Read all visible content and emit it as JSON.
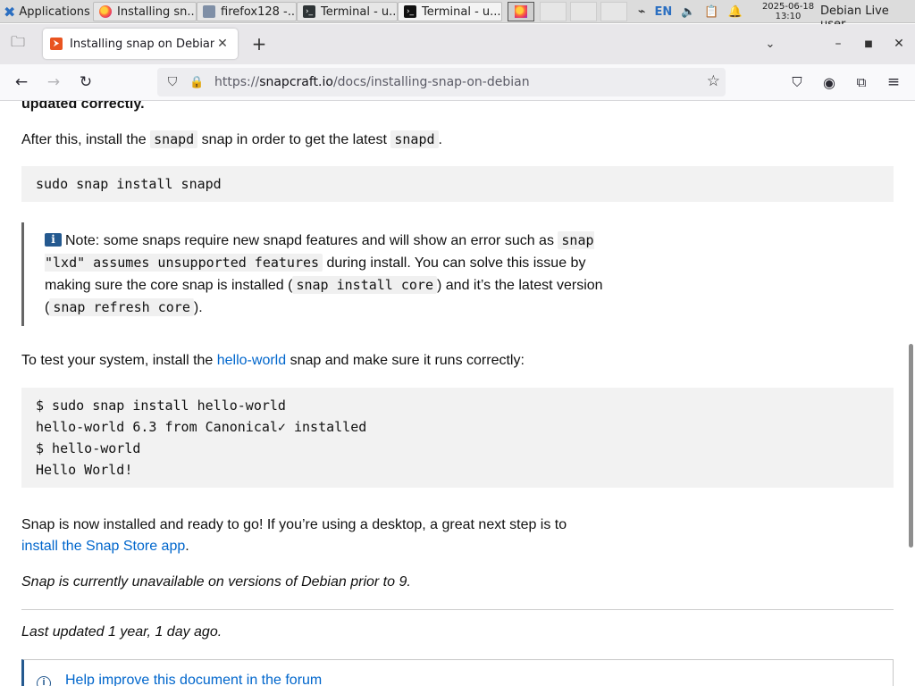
{
  "panel": {
    "applications_label": "Applications",
    "tasks": [
      {
        "label": "Installing sn..."
      },
      {
        "label": "firefox128 -..."
      },
      {
        "label": "Terminal - u..."
      },
      {
        "label": "Terminal - u..."
      }
    ],
    "keyboard_layout": "EN",
    "date": "2025-06-18",
    "time": "13:10",
    "user": "Debian Live user"
  },
  "browser": {
    "tab_title": "Installing snap on Debian",
    "url_prefix": "https://",
    "url_host": "snapcraft.io",
    "url_path": "/docs/installing-snap-on-debian"
  },
  "content": {
    "top_cut_text": "updated correctly.",
    "p1_before": "After this, install the ",
    "p1_code1": "snapd",
    "p1_middle": " snap in order to get the latest ",
    "p1_code2": "snapd",
    "p1_after": ".",
    "code1": "sudo snap install snapd",
    "note_icon": "i",
    "note_text1": "Note: some snaps require new snapd features and will show an error such as ",
    "note_code1": "snap \"lxd\" assumes unsupported features",
    "note_text2": " during install. You can solve this issue by making sure the core snap is installed (",
    "note_code2": "snap install core",
    "note_text3": ") and it’s the latest version (",
    "note_code3": "snap refresh core",
    "note_text4": ").",
    "p2_before": "To test your system, install the ",
    "p2_link": "hello-world",
    "p2_after": " snap and make sure it runs correctly:",
    "code2": "$ sudo snap install hello-world\nhello-world 6.3 from Canonical✓ installed\n$ hello-world\nHello World!",
    "p3_text": "Snap is now installed and ready to go! If you’re using a desktop, a great next step is to ",
    "p3_link": "install the Snap Store app",
    "p3_after": ".",
    "p4_italic": "Snap is currently unavailable on versions of Debian prior to 9.",
    "last_updated": "Last updated 1 year, 1 day ago.",
    "help_link": "Help improve this document in the forum"
  }
}
